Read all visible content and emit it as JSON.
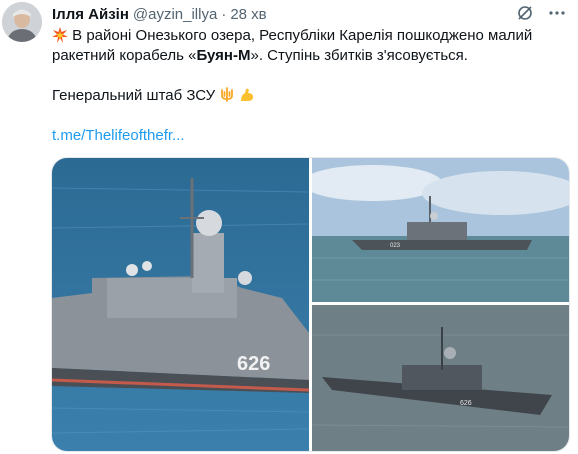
{
  "author": {
    "name": "Ілля Айзін",
    "handle": "@ayzin_illya",
    "separator": "·",
    "time": "28 хв"
  },
  "tweet": {
    "line1": "В районі Онезького озера, Республіки Карелія пошкоджено малий",
    "line2_pre": "ракетний корабель «",
    "line2_bold": "Буян-М",
    "line2_post": "». Ступінь збитків з'ясовується.",
    "line3": "Генеральний штаб ЗСУ",
    "link": "t.me/Thelifeofthefr..."
  },
  "media": {
    "hull_number_main": "626",
    "hull_number_top": "023",
    "hull_number_bottom": "626"
  },
  "icons": {
    "header": [
      "mute-icon",
      "more-icon"
    ],
    "inline": [
      "collision-emoji",
      "trident-emoji",
      "flexed-biceps-emoji"
    ]
  },
  "colors": {
    "link": "#1d9bf0",
    "secondary_text": "#536471",
    "sea_main": "#2e6f98",
    "ship_hull": "#8a9198"
  }
}
